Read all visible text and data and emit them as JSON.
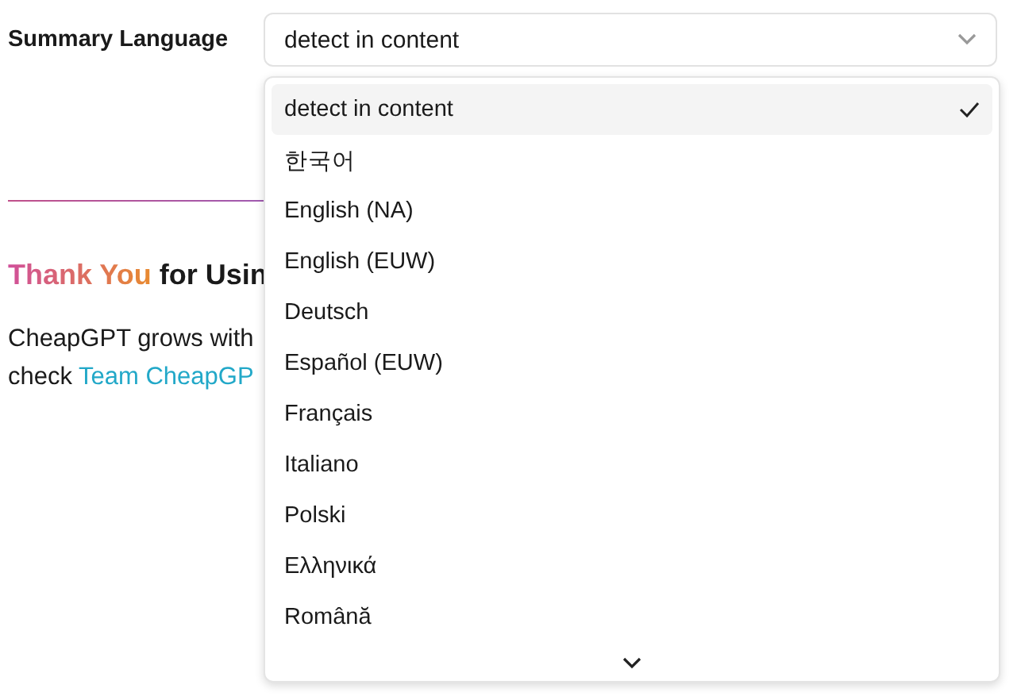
{
  "setting": {
    "label": "Summary Language",
    "value": "detect in content"
  },
  "options": [
    {
      "label": "detect in content",
      "selected": true
    },
    {
      "label": "한국어",
      "selected": false
    },
    {
      "label": "English (NA)",
      "selected": false
    },
    {
      "label": "English (EUW)",
      "selected": false
    },
    {
      "label": "Deutsch",
      "selected": false
    },
    {
      "label": "Español (EUW)",
      "selected": false
    },
    {
      "label": "Français",
      "selected": false
    },
    {
      "label": "Italiano",
      "selected": false
    },
    {
      "label": "Polski",
      "selected": false
    },
    {
      "label": "Ελληνικά",
      "selected": false
    },
    {
      "label": "Română",
      "selected": false
    }
  ],
  "thanks": {
    "highlight": "Thank You",
    "rest": "for Usin"
  },
  "message": {
    "line_1": "CheapGPT grows with",
    "line_2": "check",
    "link": "Team CheapGP"
  }
}
